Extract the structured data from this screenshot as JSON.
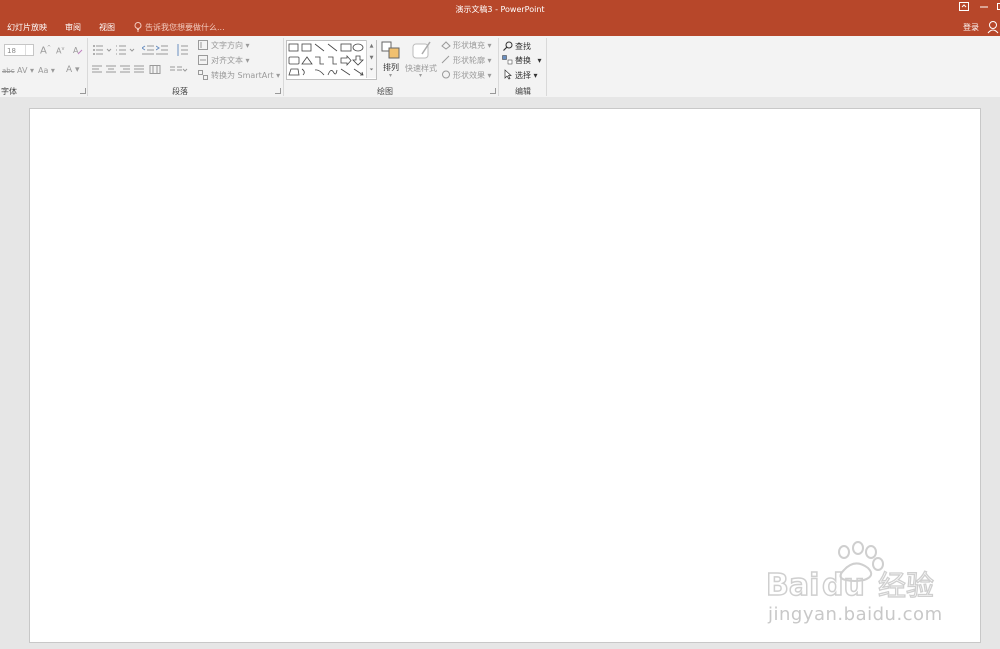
{
  "window": {
    "title": "演示文稿3 - PowerPoint",
    "login_label": "登录"
  },
  "tabs": [
    {
      "label": "幻灯片放映"
    },
    {
      "label": "审阅"
    },
    {
      "label": "视图"
    }
  ],
  "tell_me": {
    "placeholder": "告诉我您想要做什么..."
  },
  "ribbon": {
    "font_group": {
      "label": "字体",
      "font_size": "18",
      "grow_font": "A",
      "shrink_font": "A",
      "char_spacing": "AV",
      "change_case": "Aa",
      "font_color": "A",
      "strikethrough": "abc"
    },
    "paragraph_group": {
      "label": "段落",
      "text_direction": "文字方向",
      "align_text": "对齐文本",
      "convert_smartart": "转换为 SmartArt"
    },
    "drawing_group": {
      "label": "绘图",
      "arrange": "排列",
      "quick_styles": "快速样式",
      "shape_fill": "形状填充",
      "shape_outline": "形状轮廓",
      "shape_effects": "形状效果"
    },
    "editing_group": {
      "label": "编辑",
      "find": "查找",
      "replace": "替换",
      "select": "选择"
    }
  },
  "watermark": {
    "brand": "Baidu经验",
    "url": "jingyan.baidu.com"
  },
  "colors": {
    "accent": "#b7472a",
    "ribbon_bg": "#f3f3f3",
    "workspace": "#e6e6e6"
  }
}
